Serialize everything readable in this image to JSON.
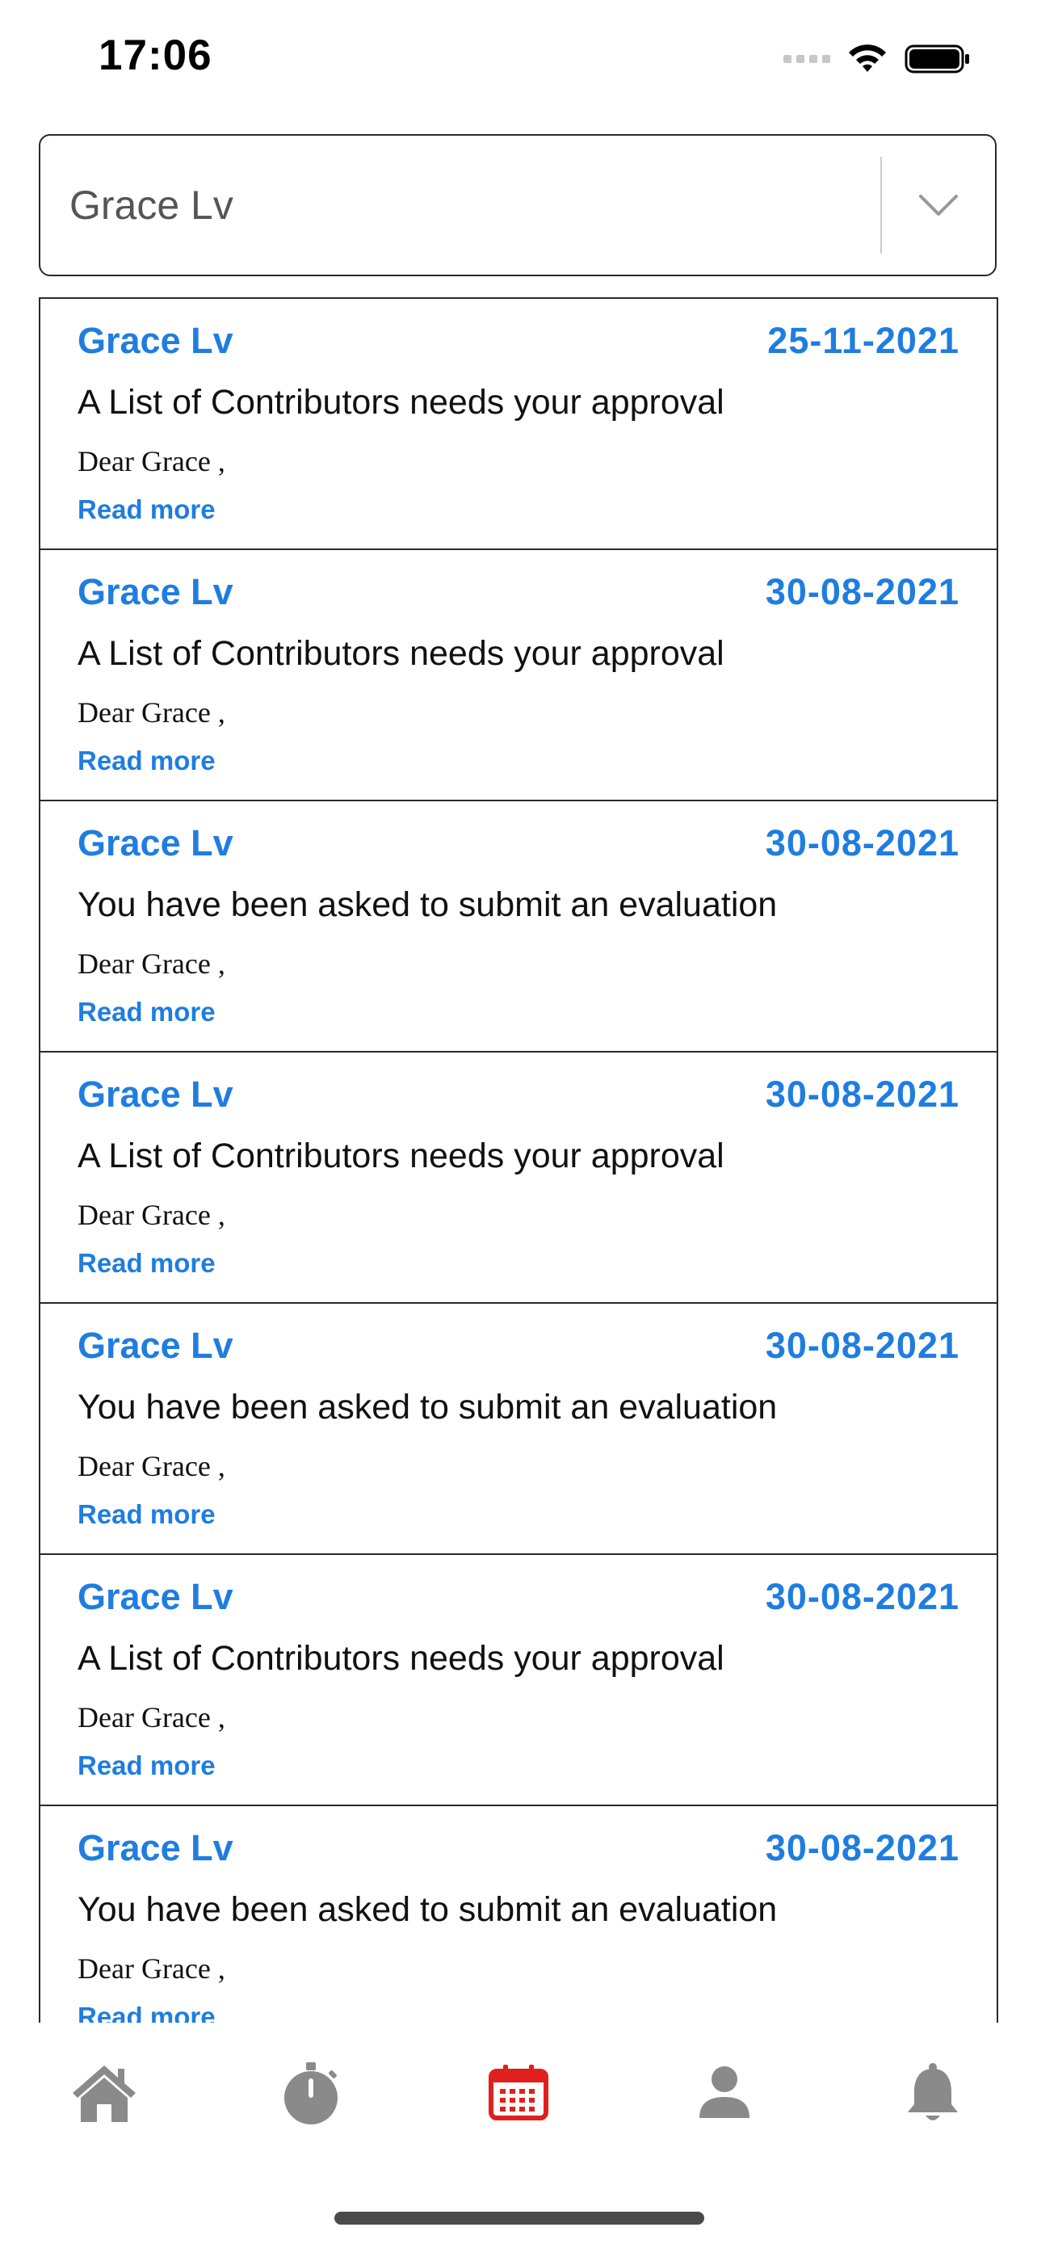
{
  "status_bar": {
    "time": "17:06",
    "icons": [
      "signal-icon",
      "wifi-icon",
      "battery-icon"
    ]
  },
  "filter": {
    "selected_value": "Grace Lv",
    "icon": "chevron-down-icon"
  },
  "notifications": [
    {
      "sender": "Grace Lv",
      "date": "25-11-2021",
      "subject": "A List of Contributors needs your approval",
      "greeting": "Dear Grace ,",
      "read_more": "Read more"
    },
    {
      "sender": "Grace Lv",
      "date": "30-08-2021",
      "subject": "A List of Contributors needs your approval",
      "greeting": "Dear Grace ,",
      "read_more": "Read more"
    },
    {
      "sender": "Grace Lv",
      "date": "30-08-2021",
      "subject": "You have been asked to submit an evaluation",
      "greeting": "Dear Grace ,",
      "read_more": "Read more"
    },
    {
      "sender": "Grace Lv",
      "date": "30-08-2021",
      "subject": "A List of Contributors needs your approval",
      "greeting": "Dear Grace ,",
      "read_more": "Read more"
    },
    {
      "sender": "Grace Lv",
      "date": "30-08-2021",
      "subject": "You have been asked to submit an evaluation",
      "greeting": "Dear Grace ,",
      "read_more": "Read more"
    },
    {
      "sender": "Grace Lv",
      "date": "30-08-2021",
      "subject": "A List of Contributors needs your approval",
      "greeting": "Dear Grace ,",
      "read_more": "Read more"
    },
    {
      "sender": "Grace Lv",
      "date": "30-08-2021",
      "subject": "You have been asked to submit an evaluation",
      "greeting": "Dear Grace ,",
      "read_more": "Read more"
    }
  ],
  "tab_bar": {
    "tabs": [
      {
        "icon": "home-icon",
        "active": false
      },
      {
        "icon": "stopwatch-icon",
        "active": false
      },
      {
        "icon": "calendar-icon",
        "active": true
      },
      {
        "icon": "person-icon",
        "active": false
      },
      {
        "icon": "bell-icon",
        "active": false
      }
    ],
    "active_color": "#e0201c",
    "inactive_color": "#8a8a8a"
  },
  "colors": {
    "accent": "#1f7de0",
    "border": "#2a2a2a"
  }
}
